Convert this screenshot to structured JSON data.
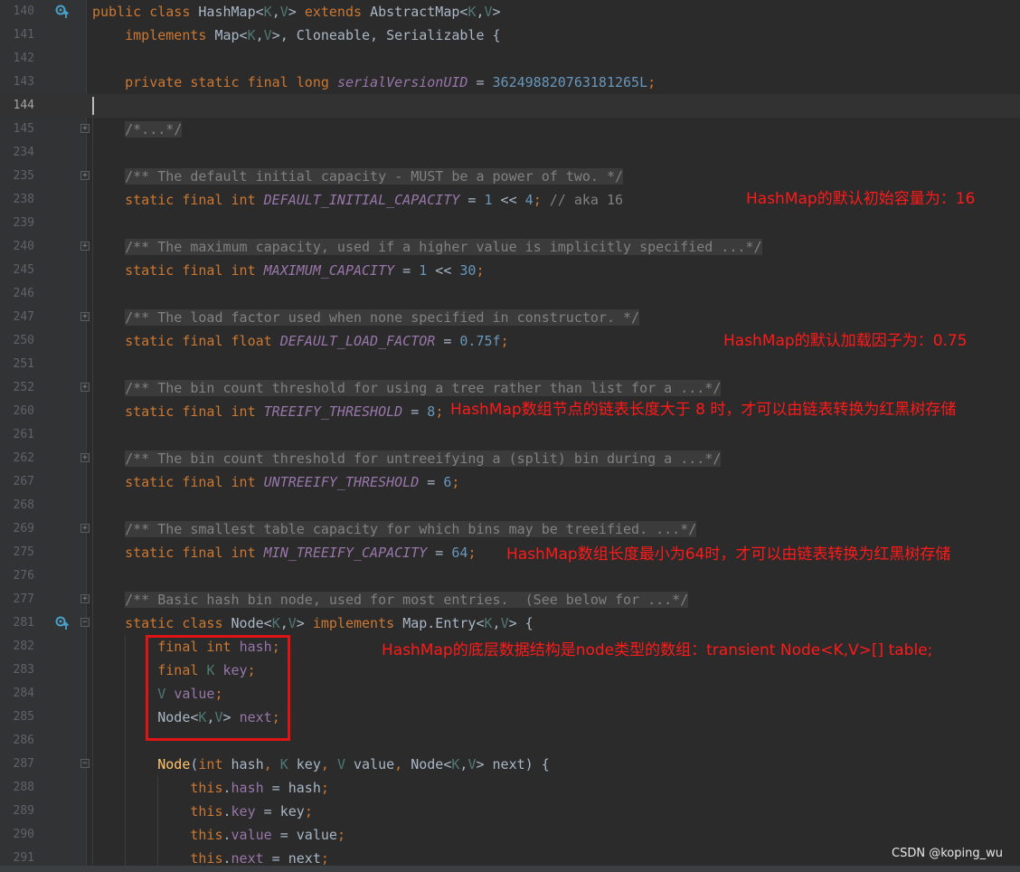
{
  "lines": [
    {
      "n": "140",
      "icon": "implements-override-icon",
      "tokens": [
        [
          "kw",
          "public class "
        ],
        [
          "",
          "HashMap<"
        ],
        [
          "tp",
          "K"
        ],
        [
          "",
          ","
        ],
        [
          "tp",
          "V"
        ],
        [
          "",
          "> "
        ],
        [
          "kw",
          "extends "
        ],
        [
          "",
          "AbstractMap<"
        ],
        [
          "tp",
          "K"
        ],
        [
          "",
          ","
        ],
        [
          "tp",
          "V"
        ],
        [
          "",
          ">"
        ]
      ]
    },
    {
      "n": "141",
      "tokens": [
        [
          "",
          "    "
        ],
        [
          "kw",
          "implements "
        ],
        [
          "",
          "Map<"
        ],
        [
          "tp",
          "K"
        ],
        [
          "",
          ","
        ],
        [
          "tp",
          "V"
        ],
        [
          "",
          ">, Cloneable, Serializable {"
        ]
      ]
    },
    {
      "n": "142",
      "tokens": []
    },
    {
      "n": "143",
      "tokens": [
        [
          "",
          "    "
        ],
        [
          "kw",
          "private static final long "
        ],
        [
          "cst",
          "serialVersionUID"
        ],
        [
          "",
          " = "
        ],
        [
          "num",
          "362498820763181265L"
        ],
        [
          "kw",
          ";"
        ]
      ]
    },
    {
      "n": "144",
      "current": true,
      "tokens": []
    },
    {
      "n": "145",
      "fold": "+",
      "tokens": [
        [
          "",
          "    "
        ],
        [
          "cm cmb",
          "/*...*/"
        ]
      ]
    },
    {
      "n": "234",
      "tokens": []
    },
    {
      "n": "235",
      "fold": "+",
      "tokens": [
        [
          "",
          "    "
        ],
        [
          "cm cmb",
          "/** The default initial capacity - MUST be a power of two. */"
        ]
      ]
    },
    {
      "n": "238",
      "tokens": [
        [
          "",
          "    "
        ],
        [
          "kw",
          "static final int "
        ],
        [
          "cst",
          "DEFAULT_INITIAL_CAPACITY"
        ],
        [
          "",
          " = "
        ],
        [
          "num",
          "1"
        ],
        [
          "",
          " << "
        ],
        [
          "num",
          "4"
        ],
        [
          "kw",
          ";"
        ],
        [
          "cm",
          " // aka 16"
        ]
      ]
    },
    {
      "n": "239",
      "tokens": []
    },
    {
      "n": "240",
      "fold": "+",
      "tokens": [
        [
          "",
          "    "
        ],
        [
          "cm cmb",
          "/** The maximum capacity, used if a higher value is implicitly specified ...*/"
        ]
      ]
    },
    {
      "n": "245",
      "tokens": [
        [
          "",
          "    "
        ],
        [
          "kw",
          "static final int "
        ],
        [
          "cst",
          "MAXIMUM_CAPACITY"
        ],
        [
          "",
          " = "
        ],
        [
          "num",
          "1"
        ],
        [
          "",
          " << "
        ],
        [
          "num",
          "30"
        ],
        [
          "kw",
          ";"
        ]
      ]
    },
    {
      "n": "246",
      "tokens": []
    },
    {
      "n": "247",
      "fold": "+",
      "tokens": [
        [
          "",
          "    "
        ],
        [
          "cm cmb",
          "/** The load factor used when none specified in constructor. */"
        ]
      ]
    },
    {
      "n": "250",
      "tokens": [
        [
          "",
          "    "
        ],
        [
          "kw",
          "static final float "
        ],
        [
          "cst",
          "DEFAULT_LOAD_FACTOR"
        ],
        [
          "",
          " = "
        ],
        [
          "num",
          "0.75f"
        ],
        [
          "kw",
          ";"
        ]
      ]
    },
    {
      "n": "251",
      "tokens": []
    },
    {
      "n": "252",
      "fold": "+",
      "tokens": [
        [
          "",
          "    "
        ],
        [
          "cm cmb",
          "/** The bin count threshold for using a tree rather than list for a ...*/"
        ]
      ]
    },
    {
      "n": "260",
      "tokens": [
        [
          "",
          "    "
        ],
        [
          "kw",
          "static final int "
        ],
        [
          "cst",
          "TREEIFY_THRESHOLD"
        ],
        [
          "",
          " = "
        ],
        [
          "num",
          "8"
        ],
        [
          "kw",
          ";"
        ]
      ]
    },
    {
      "n": "261",
      "tokens": []
    },
    {
      "n": "262",
      "fold": "+",
      "tokens": [
        [
          "",
          "    "
        ],
        [
          "cm cmb",
          "/** The bin count threshold for untreeifying a (split) bin during a ...*/"
        ]
      ]
    },
    {
      "n": "267",
      "tokens": [
        [
          "",
          "    "
        ],
        [
          "kw",
          "static final int "
        ],
        [
          "cst",
          "UNTREEIFY_THRESHOLD"
        ],
        [
          "",
          " = "
        ],
        [
          "num",
          "6"
        ],
        [
          "kw",
          ";"
        ]
      ]
    },
    {
      "n": "268",
      "tokens": []
    },
    {
      "n": "269",
      "fold": "+",
      "tokens": [
        [
          "",
          "    "
        ],
        [
          "cm cmb",
          "/** The smallest table capacity for which bins may be treeified. ...*/"
        ]
      ]
    },
    {
      "n": "275",
      "tokens": [
        [
          "",
          "    "
        ],
        [
          "kw",
          "static final int "
        ],
        [
          "cst",
          "MIN_TREEIFY_CAPACITY"
        ],
        [
          "",
          " = "
        ],
        [
          "num",
          "64"
        ],
        [
          "kw",
          ";"
        ]
      ]
    },
    {
      "n": "276",
      "tokens": []
    },
    {
      "n": "277",
      "fold": "+",
      "tokens": [
        [
          "",
          "    "
        ],
        [
          "cm cmb",
          "/** Basic hash bin node, used for most entries.  (See below for ...*/"
        ]
      ]
    },
    {
      "n": "281",
      "icon": "implements-override-icon",
      "fold": "-",
      "tokens": [
        [
          "",
          "    "
        ],
        [
          "kw",
          "static class "
        ],
        [
          "",
          "Node<"
        ],
        [
          "tp",
          "K"
        ],
        [
          "",
          ","
        ],
        [
          "tp",
          "V"
        ],
        [
          "",
          "> "
        ],
        [
          "kw",
          "implements "
        ],
        [
          "",
          "Map.Entry<"
        ],
        [
          "tp",
          "K"
        ],
        [
          "",
          ","
        ],
        [
          "tp",
          "V"
        ],
        [
          "",
          "> {"
        ]
      ]
    },
    {
      "n": "282",
      "tokens": [
        [
          "",
          "        "
        ],
        [
          "kw",
          "final int "
        ],
        [
          "fld",
          "hash"
        ],
        [
          "kw",
          ";"
        ]
      ]
    },
    {
      "n": "283",
      "tokens": [
        [
          "",
          "        "
        ],
        [
          "kw",
          "final "
        ],
        [
          "tp",
          "K "
        ],
        [
          "fld",
          "key"
        ],
        [
          "kw",
          ";"
        ]
      ]
    },
    {
      "n": "284",
      "tokens": [
        [
          "",
          "        "
        ],
        [
          "tp",
          "V "
        ],
        [
          "fld",
          "value"
        ],
        [
          "kw",
          ";"
        ]
      ]
    },
    {
      "n": "285",
      "tokens": [
        [
          "",
          "        "
        ],
        [
          "",
          "Node<"
        ],
        [
          "tp",
          "K"
        ],
        [
          "",
          ","
        ],
        [
          "tp",
          "V"
        ],
        [
          "",
          "> "
        ],
        [
          "fld",
          "next"
        ],
        [
          "kw",
          ";"
        ]
      ]
    },
    {
      "n": "286",
      "tokens": []
    },
    {
      "n": "287",
      "fold": "-",
      "tokens": [
        [
          "",
          "        "
        ],
        [
          "mth",
          "Node"
        ],
        [
          "",
          "("
        ],
        [
          "kw",
          "int "
        ],
        [
          "",
          "hash"
        ],
        [
          "kw",
          ", "
        ],
        [
          "tp",
          "K "
        ],
        [
          "",
          "key"
        ],
        [
          "kw",
          ", "
        ],
        [
          "tp",
          "V "
        ],
        [
          "",
          "value"
        ],
        [
          "kw",
          ", "
        ],
        [
          "",
          "Node<"
        ],
        [
          "tp",
          "K"
        ],
        [
          "",
          ","
        ],
        [
          "tp",
          "V"
        ],
        [
          "",
          "> next) {"
        ]
      ]
    },
    {
      "n": "288",
      "tokens": [
        [
          "",
          "            "
        ],
        [
          "kw",
          "this"
        ],
        [
          "",
          "."
        ],
        [
          "fld",
          "hash"
        ],
        [
          "",
          " = hash"
        ],
        [
          "kw",
          ";"
        ]
      ]
    },
    {
      "n": "289",
      "tokens": [
        [
          "",
          "            "
        ],
        [
          "kw",
          "this"
        ],
        [
          "",
          "."
        ],
        [
          "fld",
          "key"
        ],
        [
          "",
          " = key"
        ],
        [
          "kw",
          ";"
        ]
      ]
    },
    {
      "n": "290",
      "tokens": [
        [
          "",
          "            "
        ],
        [
          "kw",
          "this"
        ],
        [
          "",
          "."
        ],
        [
          "fld",
          "value"
        ],
        [
          "",
          " = value"
        ],
        [
          "kw",
          ";"
        ]
      ]
    },
    {
      "n": "291",
      "tokens": [
        [
          "",
          "            "
        ],
        [
          "kw",
          "this"
        ],
        [
          "",
          "."
        ],
        [
          "fld",
          "next"
        ],
        [
          "",
          " = next"
        ],
        [
          "kw",
          ";"
        ]
      ]
    }
  ],
  "annotations": {
    "default_capacity": "HashMap的默认初始容量为：16",
    "load_factor": "HashMap的默认加载因子为：0.75",
    "treeify_threshold": "HashMap数组节点的链表长度大于 8 时，才可以由链表转换为红黑树存储",
    "min_treeify_capacity": "HashMap数组长度最小为64时，才可以由链表转换为红黑树存储",
    "node_structure": "HashMap的底层数据结构是node类型的数组：transient Node<K,V>[] table;"
  },
  "watermark": "CSDN @koping_wu",
  "colors": {
    "background": "#2b2b2b",
    "gutter": "#313335",
    "keyword": "#cc7832",
    "constant": "#9876aa",
    "number": "#6897bb",
    "comment": "#808080",
    "annotation": "#ff1a1a"
  }
}
